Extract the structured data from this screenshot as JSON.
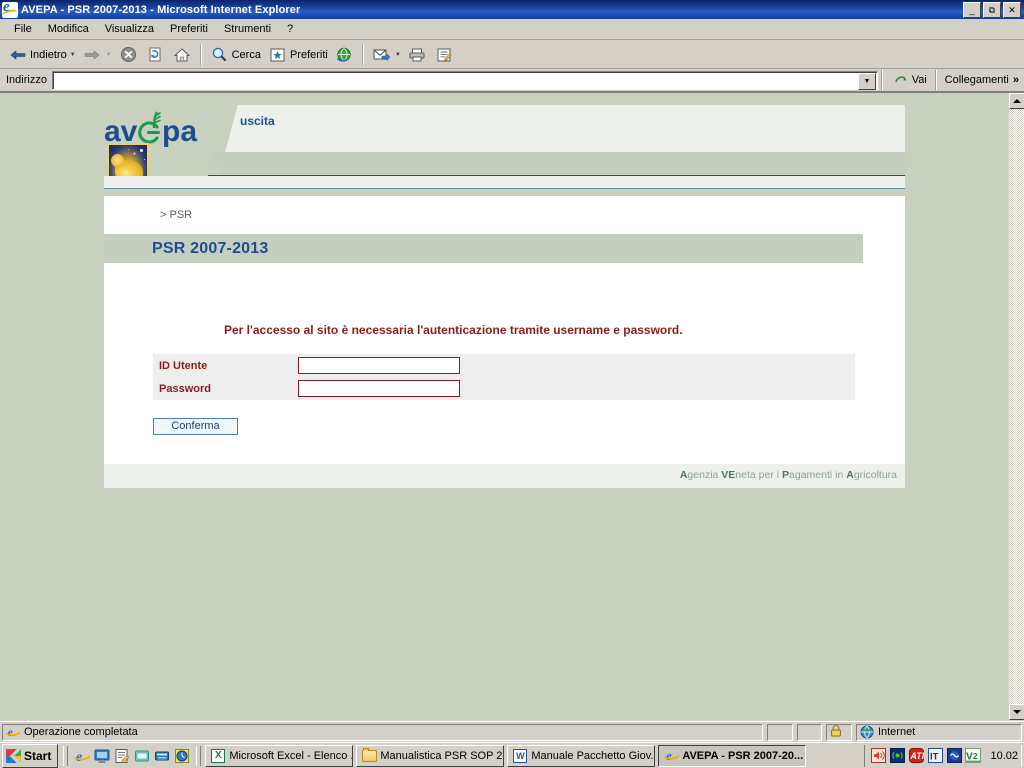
{
  "window": {
    "title": "AVEPA - PSR 2007-2013 - Microsoft Internet Explorer",
    "minimize": "_",
    "maximize": "❑",
    "close": "✕"
  },
  "menu": {
    "items": [
      "File",
      "Modifica",
      "Visualizza",
      "Preferiti",
      "Strumenti",
      "?"
    ]
  },
  "toolbar": {
    "back": "Indietro",
    "forward": "",
    "stop": "",
    "refresh": "",
    "home": "",
    "search": "Cerca",
    "favorites": "Preferiti",
    "history": "",
    "mail": "",
    "print": "",
    "edit": ""
  },
  "address": {
    "label": "Indirizzo",
    "value": "",
    "placeholder": "",
    "go": "Vai",
    "links": "Collegamenti",
    "chevron": "»"
  },
  "site": {
    "logo_alt": "avepa",
    "logo_text_av": "av",
    "logo_text_e": "e",
    "logo_text_pa": "pa",
    "uscita": "uscita",
    "breadcrumb": "> PSR",
    "page_title": "PSR 2007-2013",
    "intro": "Per l'accesso al sito è necessaria l'autenticazione tramite username e password.",
    "form": {
      "rows": [
        {
          "label": "ID Utente",
          "value": "",
          "placeholder": "",
          "type": "text"
        },
        {
          "label": "Password",
          "value": "",
          "placeholder": "",
          "type": "password"
        }
      ],
      "submit": "Conferma"
    },
    "footer": {
      "p1": "A",
      "p2": "genzia ",
      "p3": "VE",
      "p4": "neta per i ",
      "p5": "P",
      "p6": "agamenti in ",
      "p7": "A",
      "p8": "gricoltura",
      "full": "Agenzia VEneta per i Pagamenti in Agricoltura"
    }
  },
  "statusbar": {
    "message": "Operazione completata",
    "zone": "Internet"
  },
  "taskbar": {
    "start": "Start",
    "quicklaunch": [
      "ie-icon",
      "show-desktop-icon",
      "notepad-icon",
      "media-icon",
      "calculator-icon",
      "clock-icon"
    ],
    "tasks": [
      {
        "label": "Microsoft Excel - Elenco ...",
        "icon": "excel-icon",
        "active": false
      },
      {
        "label": "Manualistica PSR SOP 2...",
        "icon": "folder-icon",
        "active": false
      },
      {
        "label": "Manuale Pacchetto Giov...",
        "icon": "word-icon",
        "active": false
      },
      {
        "label": "AVEPA - PSR 2007-20...",
        "icon": "ie-icon",
        "active": true
      }
    ],
    "tray": [
      "volume-icon",
      "wireless-icon",
      "ati-icon",
      "IT",
      "network-icon",
      "V2"
    ],
    "clock": "10.02"
  },
  "colors": {
    "title_bar": "#0a246a",
    "page_bg": "#c8d0c0",
    "accent_blue": "#1d4e8f",
    "label_red": "#8b1c1c",
    "band_green": "#c4cfc0",
    "footer_green": "#4a7a5e"
  }
}
